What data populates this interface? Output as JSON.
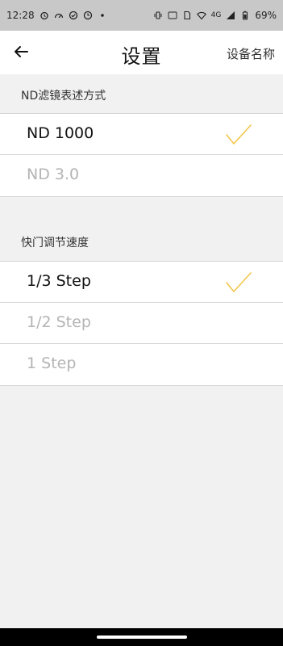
{
  "status_bar": {
    "time": "12:28",
    "battery_percent": "69%",
    "network": "4G",
    "icons_left": [
      "alarm-icon",
      "speed-icon",
      "check-circle-icon",
      "clock-icon",
      "dot-icon"
    ],
    "icons_right": [
      "vibrate-icon",
      "volte-icon",
      "sim-icon",
      "wifi-icon",
      "signal-icon",
      "battery-icon"
    ]
  },
  "header": {
    "title": "设置",
    "right_action": "设备名称",
    "back_icon": "arrow-left-icon"
  },
  "nd_section": {
    "label": "ND滤镜表述方式",
    "options": [
      {
        "label": "ND 1000",
        "selected": true
      },
      {
        "label": "ND 3.0",
        "selected": false
      }
    ]
  },
  "shutter_section": {
    "label": "快门调节速度",
    "options": [
      {
        "label": "1/3 Step",
        "selected": true
      },
      {
        "label": "1/2 Step",
        "selected": false
      },
      {
        "label": "1 Step",
        "selected": false
      }
    ]
  },
  "colors": {
    "accent": "#f3c64a",
    "selected_text": "#111111",
    "unselected_text": "#b4b4b4",
    "background": "#f1f1f1"
  }
}
